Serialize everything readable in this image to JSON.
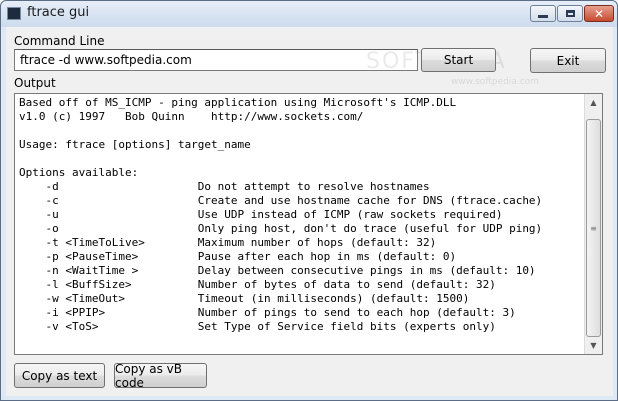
{
  "window": {
    "title": "ftrace gui"
  },
  "command": {
    "label": "Command Line",
    "value": "ftrace -d www.softpedia.com"
  },
  "buttons": {
    "start": "Start",
    "exit": "Exit",
    "copy_text": "Copy as text",
    "copy_vb": "Copy as vB code"
  },
  "output": {
    "label": "Output",
    "lines": [
      "Based off of MS_ICMP - ping application using Microsoft's ICMP.DLL",
      "v1.0 (c) 1997   Bob Quinn    http://www.sockets.com/",
      "",
      "Usage: ftrace [options] target_name",
      "",
      "Options available:",
      "    -d                     Do not attempt to resolve hostnames",
      "    -c                     Create and use hostname cache for DNS (ftrace.cache)",
      "    -u                     Use UDP instead of ICMP (raw sockets required)",
      "    -o                     Only ping host, don't do trace (useful for UDP ping)",
      "    -t <TimeToLive>        Maximum number of hops (default: 32)",
      "    -p <PauseTime>         Pause after each hop in ms (default: 0)",
      "    -n <WaitTime >         Delay between consecutive pings in ms (default: 10)",
      "    -l <BuffSize>          Number of bytes of data to send (default: 32)",
      "    -w <TimeOut>           Timeout (in milliseconds) (default: 1500)",
      "    -i <PPIP>              Number of pings to send to each hop (default: 3)",
      "    -v <ToS>               Set Type of Service field bits (experts only)"
    ]
  },
  "watermark": {
    "text": "SOFTPEDIA",
    "url": "www.softpedia.com"
  }
}
